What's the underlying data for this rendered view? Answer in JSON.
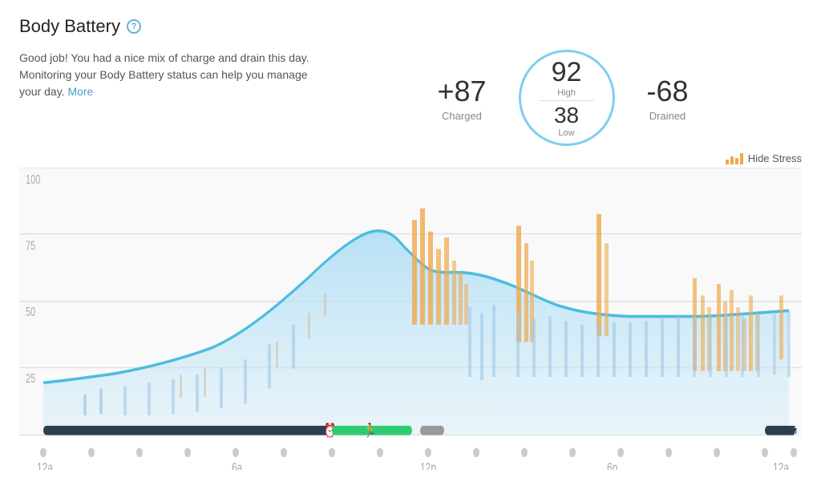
{
  "header": {
    "title": "Body Battery",
    "help_icon": "?"
  },
  "description": {
    "text": "Good job! You had a nice mix of charge and drain this day. Monitoring your Body Battery status can help you manage your day.",
    "more_label": "More"
  },
  "stats": {
    "charged_value": "+87",
    "charged_label": "Charged",
    "high_value": "92",
    "high_label": "High",
    "low_value": "38",
    "low_label": "Low",
    "drained_value": "-68",
    "drained_label": "Drained"
  },
  "chart": {
    "hide_stress_label": "Hide Stress",
    "y_labels": [
      "100",
      "75",
      "50",
      "25"
    ],
    "x_labels": [
      "12a",
      "6a",
      "12p",
      "6p",
      "12a"
    ]
  }
}
